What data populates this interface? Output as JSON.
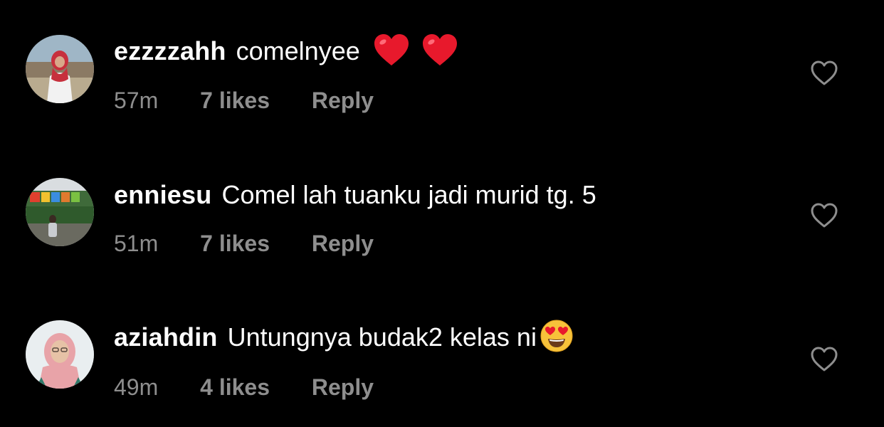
{
  "comments": [
    {
      "username": "ezzzzahh",
      "text": "comelnyee",
      "emojis": [
        "red-heart",
        "red-heart"
      ],
      "time": "57m",
      "likes": "7 likes",
      "reply": "Reply",
      "avatar": "avatar-girl-red-hijab-beach"
    },
    {
      "username": "enniesu",
      "text": "Comel lah tuanku jadi murid tg. 5",
      "emojis": [],
      "time": "51m",
      "likes": "7 likes",
      "reply": "Reply",
      "avatar": "avatar-person-outdoor-sign"
    },
    {
      "username": "aziahdin",
      "text": "Untungnya budak2 kelas ni",
      "emojis": [
        "heart-eyes-face"
      ],
      "time": "49m",
      "likes": "4 likes",
      "reply": "Reply",
      "avatar": "avatar-woman-pink-hijab"
    }
  ],
  "colors": {
    "background": "#000000",
    "primary_text": "#ffffff",
    "secondary_text": "#8e8e8e",
    "heart_red": "#e8192c",
    "emoji_yellow": "#f7c23a"
  },
  "icons": {
    "like": "heart-outline-icon"
  }
}
